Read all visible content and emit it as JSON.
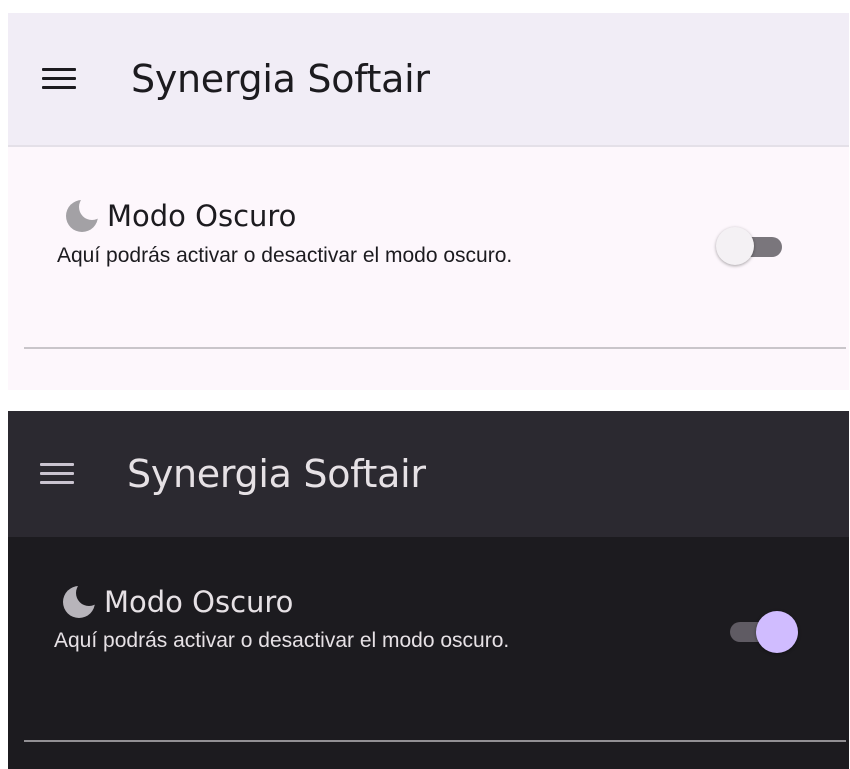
{
  "light_screen": {
    "app_title": "Synergia Softair",
    "setting": {
      "icon": "moon-icon",
      "title": "Modo Oscuro",
      "description": "Aquí podrás activar o desactivar el modo oscuro.",
      "toggle_state": "off"
    },
    "colors": {
      "appbar_bg": "#f1edf6",
      "body_bg": "#fdf7fc",
      "toggle_thumb": "#f4f1f4"
    }
  },
  "dark_screen": {
    "app_title": "Synergia Softair",
    "setting": {
      "icon": "moon-icon",
      "title": "Modo Oscuro",
      "description": "Aquí podrás activar o desactivar el modo oscuro.",
      "toggle_state": "on"
    },
    "colors": {
      "appbar_bg": "#2b2930",
      "body_bg": "#1c1b1f",
      "toggle_thumb": "#d0bcff"
    }
  }
}
